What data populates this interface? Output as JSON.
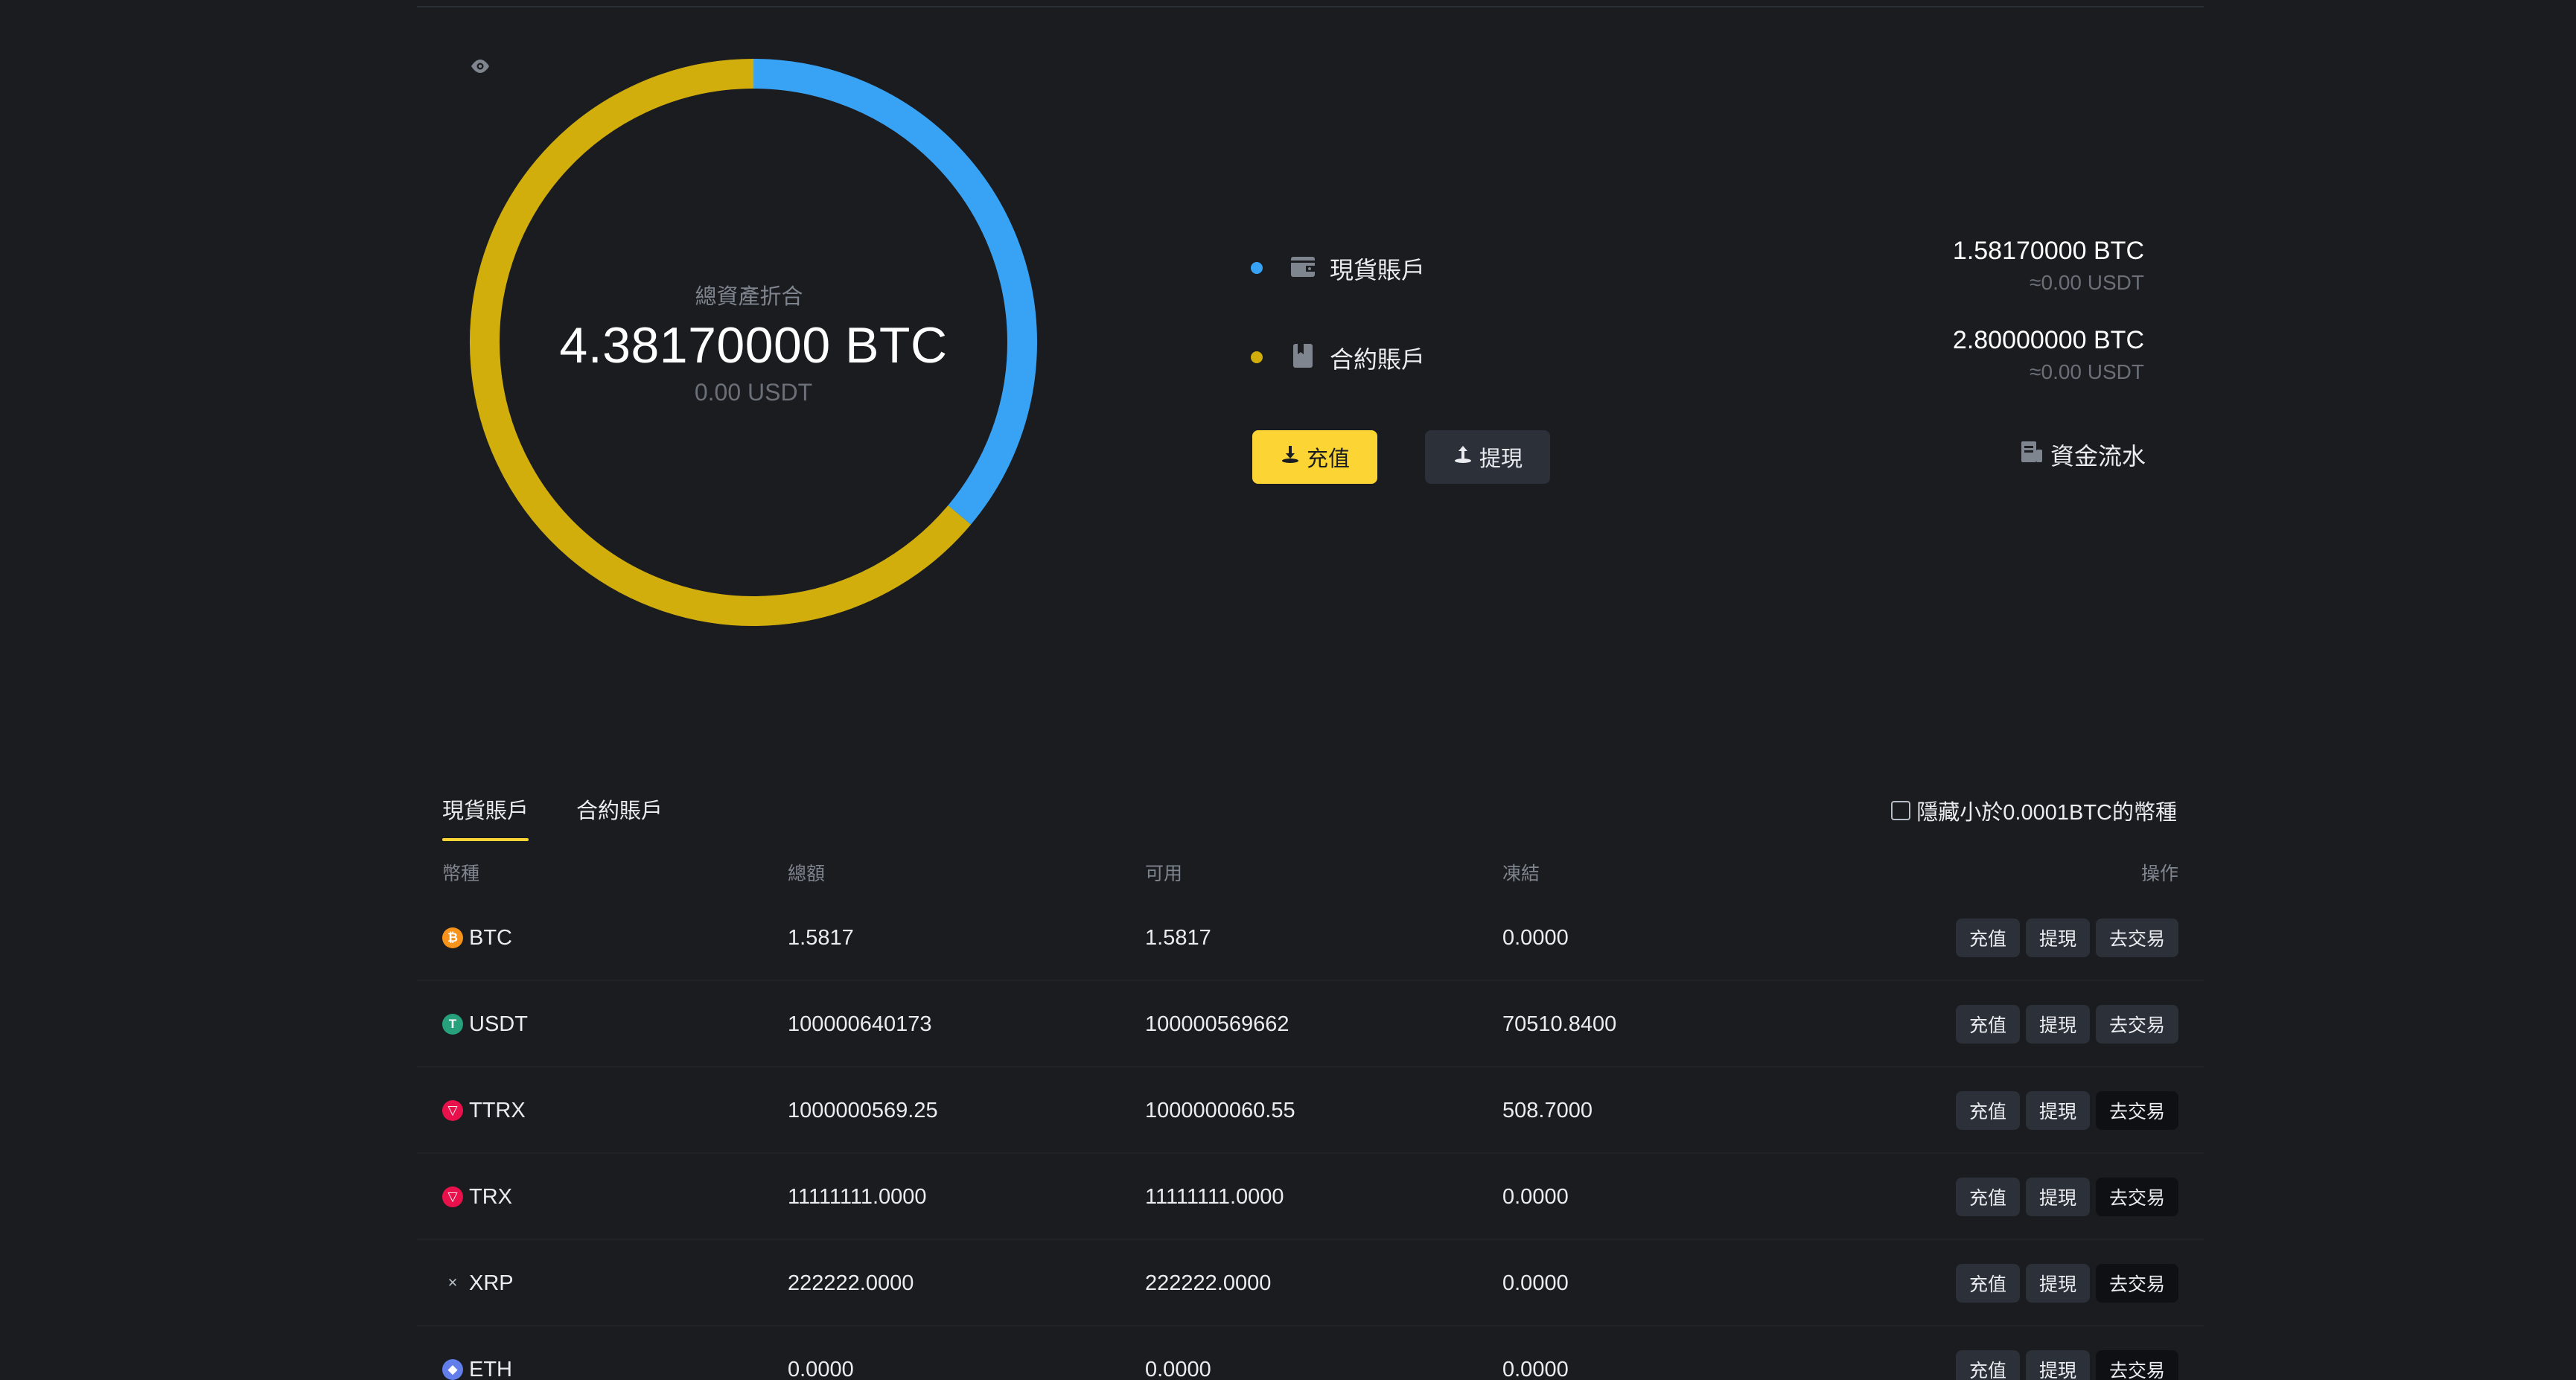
{
  "summary": {
    "total_label": "總資產折合",
    "total_btc": "4.38170000 BTC",
    "total_usdt": "0.00 USDT",
    "accounts": [
      {
        "name": "現貨賬戶",
        "btc": "1.58170000 BTC",
        "usdt": "≈0.00 USDT",
        "color": "#38a3f5",
        "icon": "wallet-icon",
        "share": 0.361
      },
      {
        "name": "合約賬戶",
        "btc": "2.80000000 BTC",
        "usdt": "≈0.00 USDT",
        "color": "#d1ae0b",
        "icon": "book-icon",
        "share": 0.639
      }
    ],
    "deposit_label": "充值",
    "withdraw_label": "提現",
    "fund_flow_label": "資金流水"
  },
  "tabs": [
    {
      "label": "現貨賬戶",
      "active": true
    },
    {
      "label": "合約賬戶",
      "active": false
    }
  ],
  "hide_small_label": "隱藏小於0.0001BTC的幣種",
  "table": {
    "headers": [
      "幣種",
      "總額",
      "可用",
      "凍結",
      "操作"
    ],
    "rows": [
      {
        "coin": "BTC",
        "total": "1.5817",
        "available": "1.5817",
        "frozen": "0.0000",
        "icon_color": "#f7931a",
        "glyph": "₿",
        "trade_dark": false
      },
      {
        "coin": "USDT",
        "total": "100000640173",
        "available": "100000569662",
        "frozen": "70510.8400",
        "icon_color": "#26a17b",
        "glyph": "T",
        "trade_dark": false
      },
      {
        "coin": "TTRX",
        "total": "1000000569.25",
        "available": "1000000060.55",
        "frozen": "508.7000",
        "icon_color": "#e8114b",
        "glyph": "▽",
        "trade_dark": true
      },
      {
        "coin": "TRX",
        "total": "11111111.0000",
        "available": "11111111.0000",
        "frozen": "0.0000",
        "icon_color": "#e8114b",
        "glyph": "▽",
        "trade_dark": true
      },
      {
        "coin": "XRP",
        "total": "222222.0000",
        "available": "222222.0000",
        "frozen": "0.0000",
        "icon_color": "#23292f",
        "glyph": "✕",
        "trade_dark": true
      },
      {
        "coin": "ETH",
        "total": "0.0000",
        "available": "0.0000",
        "frozen": "0.0000",
        "icon_color": "#627eea",
        "glyph": "◆",
        "trade_dark": true
      }
    ],
    "op_labels": {
      "deposit": "充值",
      "withdraw": "提現",
      "trade": "去交易"
    }
  }
}
